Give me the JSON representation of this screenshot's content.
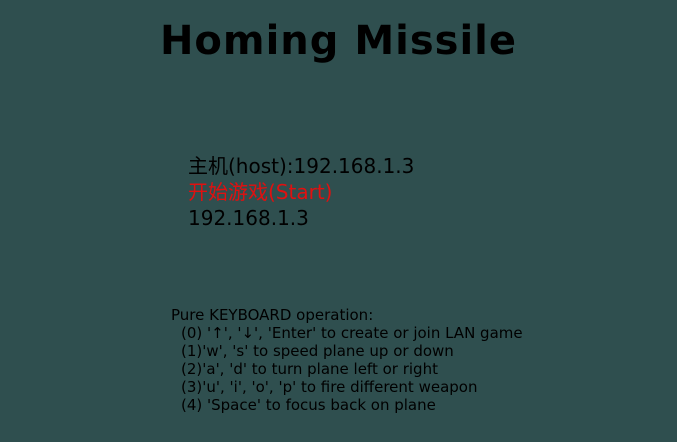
{
  "game": {
    "title": "Homing Missile"
  },
  "menu": {
    "items": [
      {
        "label": "主机(host):192.168.1.3",
        "selected": false
      },
      {
        "label": "开始游戏(Start)",
        "selected": true
      },
      {
        "label": "192.168.1.3",
        "selected": false
      }
    ],
    "selected_color": "#e01010"
  },
  "help": {
    "heading": "Pure KEYBOARD operation:",
    "lines": [
      "(0) '↑', '↓', 'Enter' to create or join LAN game",
      "(1)'w', 's' to speed plane up or down",
      "(2)'a', 'd' to turn plane left or right",
      "(3)'u', 'i', 'o', 'p' to fire different weapon",
      "(4) 'Space' to focus back on plane"
    ]
  },
  "colors": {
    "background": "#2f4f4f",
    "text": "#000000"
  }
}
